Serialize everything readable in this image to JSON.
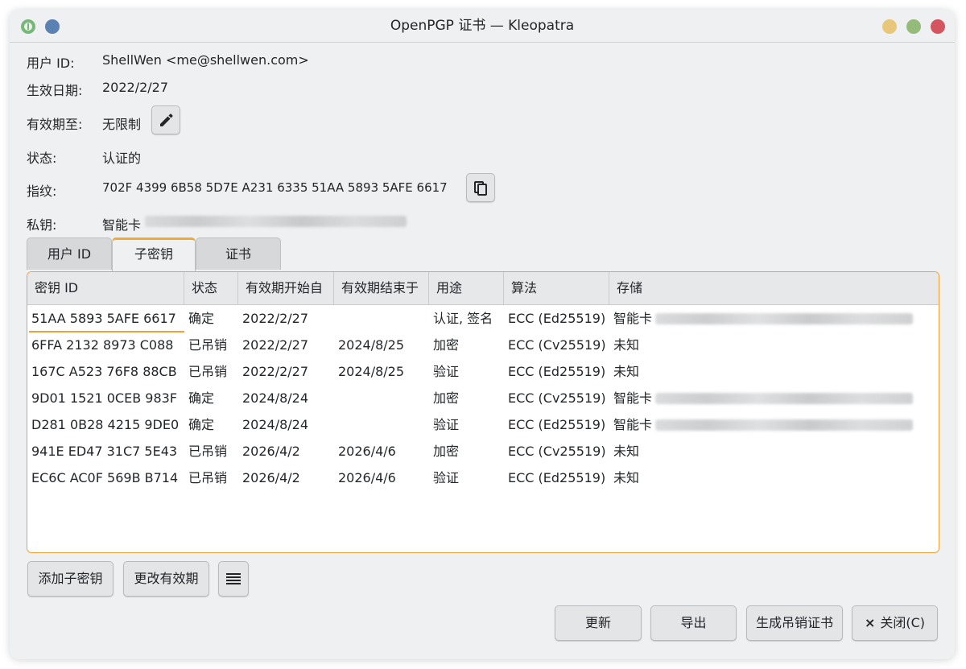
{
  "window": {
    "title": "OpenPGP 证书 — Kleopatra"
  },
  "details": {
    "user_id": {
      "label": "用户 ID:",
      "value": "ShellWen <me@shellwen.com>"
    },
    "valid_from": {
      "label": "生效日期:",
      "value": "2022/2/27"
    },
    "expires": {
      "label": "有效期至:",
      "value": "无限制"
    },
    "status": {
      "label": "状态:",
      "value": "认证的"
    },
    "fingerprint": {
      "label": "指纹:",
      "value": "702F 4399 6B58 5D7E A231  6335 51AA 5893 5AFE 6617"
    },
    "private_key": {
      "label": "私钥:",
      "value": "智能卡"
    }
  },
  "tabs": [
    "用户 ID",
    "子密钥",
    "证书"
  ],
  "active_tab": "子密钥",
  "subkeys": {
    "columns": [
      "密钥 ID",
      "状态",
      "有效期开始自",
      "有效期结束于",
      "用途",
      "算法",
      "存储"
    ],
    "rows": [
      [
        "51AA 5893 5AFE 6617",
        "确定",
        "2022/2/27",
        "",
        "认证, 签名",
        "ECC (Ed25519)",
        "智能卡"
      ],
      [
        "6FFA 2132 8973 C088",
        "已吊销",
        "2022/2/27",
        "2024/8/25",
        "加密",
        "ECC (Cv25519)",
        "未知"
      ],
      [
        "167C A523 76F8 88CB",
        "已吊销",
        "2022/2/27",
        "2024/8/25",
        "验证",
        "ECC (Ed25519)",
        "未知"
      ],
      [
        "9D01 1521 0CEB 983F",
        "确定",
        "2024/8/24",
        "",
        "加密",
        "ECC (Cv25519)",
        "智能卡"
      ],
      [
        "D281 0B28 4215 9DE0",
        "确定",
        "2024/8/24",
        "",
        "验证",
        "ECC (Ed25519)",
        "智能卡"
      ],
      [
        "941E ED47 31C7 5E43",
        "已吊销",
        "2026/4/2",
        "2026/4/6",
        "加密",
        "ECC (Cv25519)",
        "未知"
      ],
      [
        "EC6C AC0F 569B B714",
        "已吊销",
        "2026/4/2",
        "2026/4/6",
        "验证",
        "ECC (Ed25519)",
        "未知"
      ]
    ]
  },
  "subkey_actions": {
    "add": "添加子密钥",
    "change_expiry": "更改有效期",
    "menu_icon": "hamburger-menu-icon"
  },
  "footer": {
    "refresh": "更新",
    "export": "导出",
    "revoke": "生成吊销证书",
    "close": "关闭(C)",
    "close_icon": "×"
  },
  "icons": {
    "edit": "pencil-icon",
    "copy": "copy-icon"
  },
  "colors": {
    "accent": "#f0a23a",
    "window_bg": "#eff0f1",
    "close": "#d4545f",
    "minimize": "#e8c67a",
    "maximize": "#94bb7a"
  }
}
